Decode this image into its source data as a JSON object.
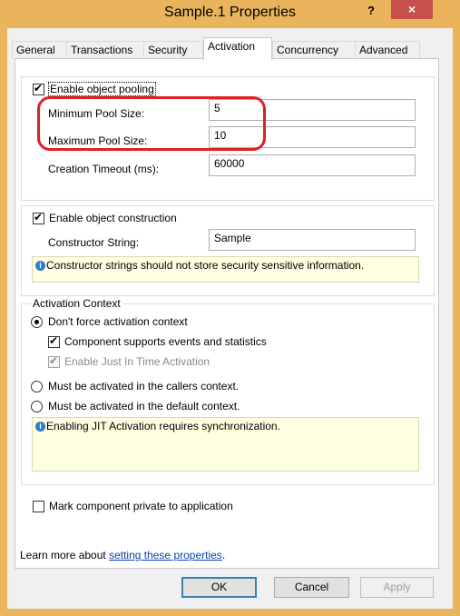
{
  "window": {
    "title": "Sample.1 Properties",
    "help": "?",
    "close": "×"
  },
  "tabs": [
    "General",
    "Transactions",
    "Security",
    "Activation",
    "Concurrency",
    "Advanced"
  ],
  "pooling": {
    "enable_label": "Enable object pooling",
    "min_label": "Minimum Pool Size:",
    "min_value": "5",
    "max_label": "Maximum Pool Size:",
    "max_value": "10",
    "timeout_label": "Creation Timeout (ms):",
    "timeout_value": "60000"
  },
  "construction": {
    "enable_label": "Enable object construction",
    "ctor_label": "Constructor String:",
    "ctor_value": "Sample",
    "info": "Constructor strings should not store security sensitive information."
  },
  "activation_context": {
    "title": "Activation Context",
    "dont_force": "Don't force activation context",
    "events": "Component supports events and statistics",
    "jit": "Enable Just In Time Activation",
    "callers": "Must be activated in the callers context.",
    "default": "Must be activated in the default context.",
    "info": "Enabling JIT Activation requires synchronization."
  },
  "private_label": "Mark component private to application",
  "learn": {
    "prefix": "Learn more about ",
    "link": "setting these properties",
    "suffix": "."
  },
  "buttons": {
    "ok": "OK",
    "cancel": "Cancel",
    "apply": "Apply"
  },
  "colors": {
    "frame": "#e9b45c",
    "close": "#c7504b",
    "highlight": "#e02020",
    "info_bg": "#ffffe1"
  }
}
